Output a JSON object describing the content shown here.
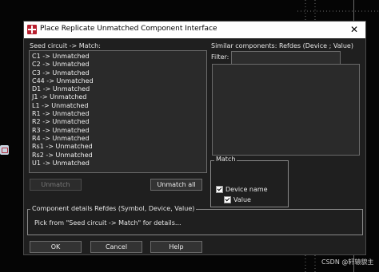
{
  "window": {
    "title": "Place Replicate Unmatched Component Interface",
    "close_glyph": "✕"
  },
  "seed": {
    "label": "Seed circuit -> Match:",
    "items": [
      "C1 -> Unmatched",
      "C2 -> Unmatched",
      "C3 -> Unmatched",
      "C44 -> Unmatched",
      "D1 -> Unmatched",
      "J1 -> Unmatched",
      "L1 -> Unmatched",
      "R1 -> Unmatched",
      "R2 -> Unmatched",
      "R3 -> Unmatched",
      "R4 -> Unmatched",
      "Rs1 -> Unmatched",
      "Rs2 -> Unmatched",
      "U1 -> Unmatched"
    ]
  },
  "buttons": {
    "unmatch": "Unmatch",
    "unmatch_all": "Unmatch all",
    "ok": "OK",
    "cancel": "Cancel",
    "help": "Help"
  },
  "similar": {
    "label": "Similar components:  Refdes  (Device ; Value)",
    "filter_label": "Filter:",
    "filter_value": ""
  },
  "match": {
    "title": "Match",
    "device_name_label": "Device name",
    "device_name_checked": true,
    "value_label": "Value",
    "value_checked": true
  },
  "details": {
    "title": "Component details  Refdes (Symbol, Device, Value)",
    "text": "Pick from \"Seed circuit -> Match\" for details..."
  },
  "watermark": "CSDN @轩辕貌主",
  "icons": {
    "app": "replicate-app-icon",
    "close": "close-icon"
  }
}
